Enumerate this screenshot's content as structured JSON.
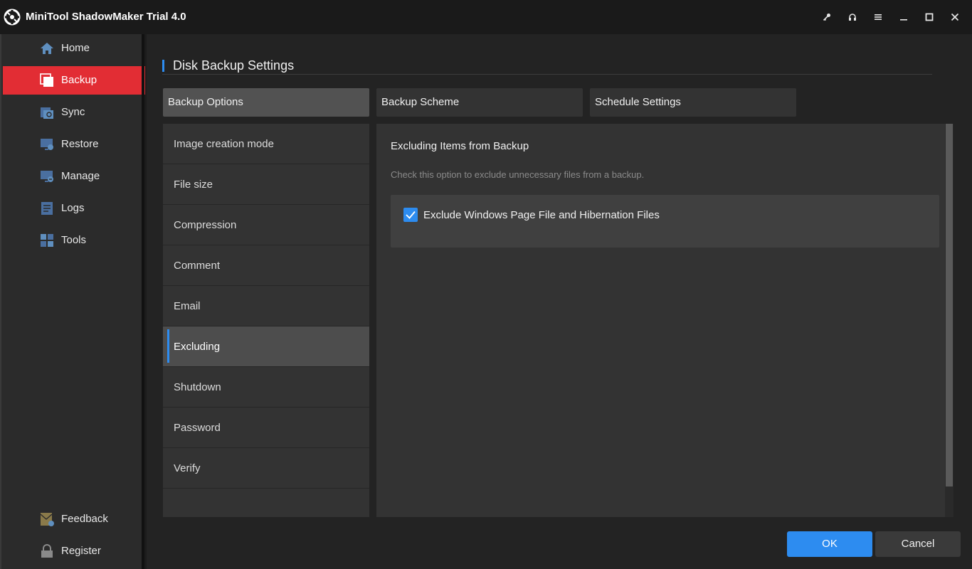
{
  "app": {
    "title": "MiniTool ShadowMaker Trial 4.0"
  },
  "colors": {
    "accent": "#2d8cf0",
    "active_nav": "#e22d34"
  },
  "window_controls": [
    {
      "name": "key-icon"
    },
    {
      "name": "headset-icon"
    },
    {
      "name": "menu-icon"
    },
    {
      "name": "minimize-icon"
    },
    {
      "name": "maximize-icon"
    },
    {
      "name": "close-icon"
    }
  ],
  "sidebar": {
    "items": [
      {
        "label": "Home",
        "icon": "home-icon",
        "active": false
      },
      {
        "label": "Backup",
        "icon": "backup-icon",
        "active": true
      },
      {
        "label": "Sync",
        "icon": "sync-icon",
        "active": false
      },
      {
        "label": "Restore",
        "icon": "restore-icon",
        "active": false
      },
      {
        "label": "Manage",
        "icon": "manage-icon",
        "active": false
      },
      {
        "label": "Logs",
        "icon": "logs-icon",
        "active": false
      },
      {
        "label": "Tools",
        "icon": "tools-icon",
        "active": false
      }
    ],
    "bottom_items": [
      {
        "label": "Feedback",
        "icon": "feedback-icon"
      },
      {
        "label": "Register",
        "icon": "lock-icon"
      }
    ]
  },
  "main": {
    "title": "Disk Backup Settings",
    "tabs": [
      {
        "label": "Backup Options",
        "active": true
      },
      {
        "label": "Backup Scheme",
        "active": false
      },
      {
        "label": "Schedule Settings",
        "active": false
      }
    ],
    "options": [
      {
        "label": "Image creation mode",
        "active": false
      },
      {
        "label": "File size",
        "active": false
      },
      {
        "label": "Compression",
        "active": false
      },
      {
        "label": "Comment",
        "active": false
      },
      {
        "label": "Email",
        "active": false
      },
      {
        "label": "Excluding",
        "active": true
      },
      {
        "label": "Shutdown",
        "active": false
      },
      {
        "label": "Password",
        "active": false
      },
      {
        "label": "Verify",
        "active": false
      }
    ],
    "detail": {
      "title": "Excluding Items from Backup",
      "description": "Check this option to exclude unnecessary files from a backup.",
      "checkbox_label": "Exclude Windows Page File and Hibernation Files",
      "checked": true
    },
    "buttons": {
      "ok": "OK",
      "cancel": "Cancel"
    }
  }
}
